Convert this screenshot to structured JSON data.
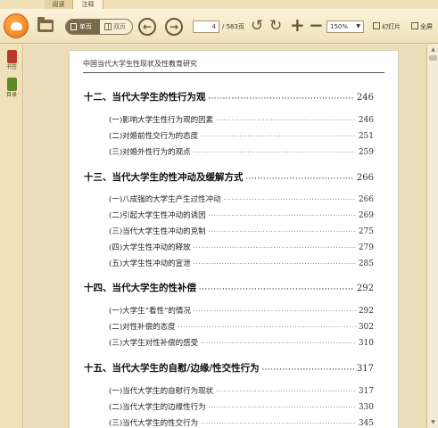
{
  "tabs": [
    {
      "label": "阅读"
    },
    {
      "label": "注释"
    }
  ],
  "toolbar": {
    "single_page_label": "单页",
    "double_page_label": "双页",
    "current_page": "4",
    "page_total": "/ 583页",
    "zoom_value": "150%",
    "slideshow_label": "幻灯片",
    "fullscreen_label": "全屏"
  },
  "sidebar": {
    "bookmarks_label": "书签",
    "toc_label": "目录"
  },
  "page": {
    "running_head": "中国当代大学生性现状及性教育研究"
  },
  "toc": {
    "chapters": [
      {
        "title": "十二、当代大学生的性行为观",
        "page": "246",
        "sections": [
          {
            "title": "(一)影响大学生性行为观的因素",
            "page": "246"
          },
          {
            "title": "(二)对婚前性交行为的态度",
            "page": "251"
          },
          {
            "title": "(三)对婚外性行为的观点",
            "page": "259"
          }
        ]
      },
      {
        "title": "十三、当代大学生的性冲动及缓解方式",
        "page": "266",
        "sections": [
          {
            "title": "(一)八成强的大学生产生过性冲动",
            "page": "266"
          },
          {
            "title": "(二)引起大学生性冲动的诱因",
            "page": "269"
          },
          {
            "title": "(三)当代大学生性冲动的克制",
            "page": "275"
          },
          {
            "title": "(四)大学生性冲动的释放",
            "page": "279"
          },
          {
            "title": "(五)大学生性冲动的宣泄",
            "page": "285"
          }
        ]
      },
      {
        "title": "十四、当代大学生的性补偿",
        "page": "292",
        "sections": [
          {
            "title": "(一)大学生“看性”的情况",
            "page": "292"
          },
          {
            "title": "(二)对性补偿的态度",
            "page": "302"
          },
          {
            "title": "(三)大学生对性补偿的感受",
            "page": "310"
          }
        ]
      },
      {
        "title": "十五、当代大学生的自慰/边缘/性交性行为",
        "page": "317",
        "sections": [
          {
            "title": "(一)当代大学生的自慰行为现状",
            "page": "317"
          },
          {
            "title": "(二)当代大学生的边缘性行为",
            "page": "330"
          },
          {
            "title": "(三)当代大学生的性交行为",
            "page": "345"
          }
        ]
      }
    ]
  }
}
